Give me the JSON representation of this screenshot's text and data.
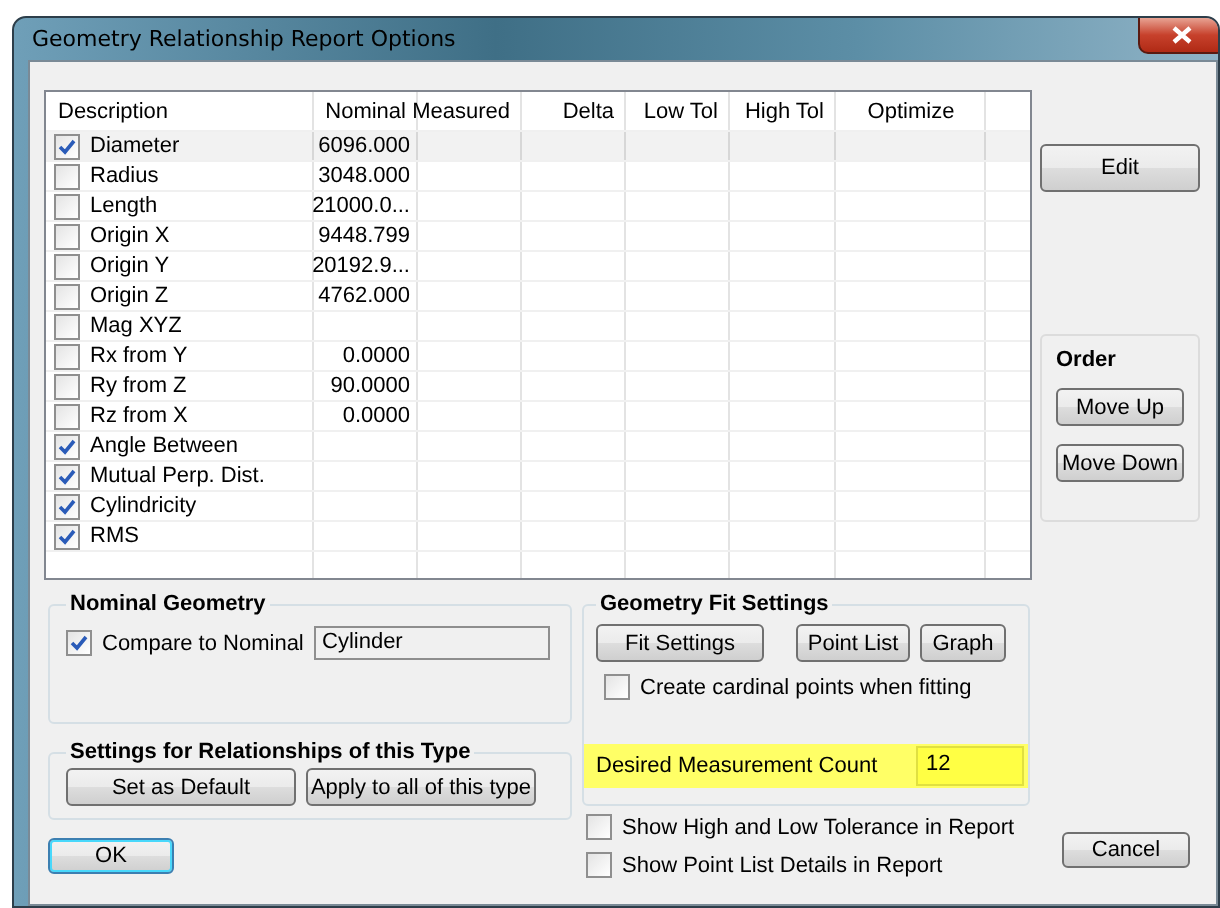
{
  "window": {
    "title": "Geometry Relationship Report Options"
  },
  "table": {
    "columns": [
      "Description",
      "Nominal",
      "Measured",
      "Delta",
      "Low Tol",
      "High Tol",
      "Optimize"
    ],
    "rows": [
      {
        "checked": true,
        "description": "Diameter",
        "nominal": "6096.000",
        "selected": true
      },
      {
        "checked": false,
        "description": "Radius",
        "nominal": "3048.000",
        "selected": false
      },
      {
        "checked": false,
        "description": "Length",
        "nominal": "21000.0...",
        "selected": false
      },
      {
        "checked": false,
        "description": "Origin X",
        "nominal": "9448.799",
        "selected": false
      },
      {
        "checked": false,
        "description": "Origin Y",
        "nominal": "20192.9...",
        "selected": false
      },
      {
        "checked": false,
        "description": "Origin Z",
        "nominal": "4762.000",
        "selected": false
      },
      {
        "checked": false,
        "description": "Mag XYZ",
        "selected": false
      },
      {
        "checked": false,
        "description": "Rx from Y",
        "nominal": "0.0000",
        "selected": false
      },
      {
        "checked": false,
        "description": "Ry from Z",
        "nominal": "90.0000",
        "selected": false
      },
      {
        "checked": false,
        "description": "Rz from X",
        "nominal": "0.0000",
        "selected": false
      },
      {
        "checked": true,
        "description": "Angle Between",
        "selected": false
      },
      {
        "checked": true,
        "description": "Mutual Perp. Dist.",
        "selected": false
      },
      {
        "checked": true,
        "description": "Cylindricity",
        "selected": false
      },
      {
        "checked": true,
        "description": "RMS",
        "selected": false
      }
    ]
  },
  "edit_button": "Edit",
  "order": {
    "title": "Order",
    "buttons": [
      "Move Up",
      "Move Down"
    ]
  },
  "nominal_geometry": {
    "title": "Nominal Geometry",
    "compare": {
      "label": "Compare to Nominal",
      "checked": true
    },
    "value": "Cylinder"
  },
  "type_settings": {
    "title": "Settings for Relationships of this Type",
    "buttons": [
      "Set as Default",
      "Apply to all of this type"
    ]
  },
  "fit_settings": {
    "title": "Geometry Fit Settings",
    "buttons": [
      "Fit Settings",
      "Point List",
      "Graph"
    ],
    "cardinal": {
      "label": "Create cardinal points when fitting",
      "checked": false
    },
    "count": {
      "label": "Desired Measurement Count",
      "value": "12",
      "highlighted": true
    }
  },
  "report_options": [
    {
      "label": "Show High and Low Tolerance in Report",
      "checked": false
    },
    {
      "label": "Show Point List Details in Report",
      "checked": false
    }
  ],
  "ok_button": "OK",
  "cancel_button": "Cancel"
}
